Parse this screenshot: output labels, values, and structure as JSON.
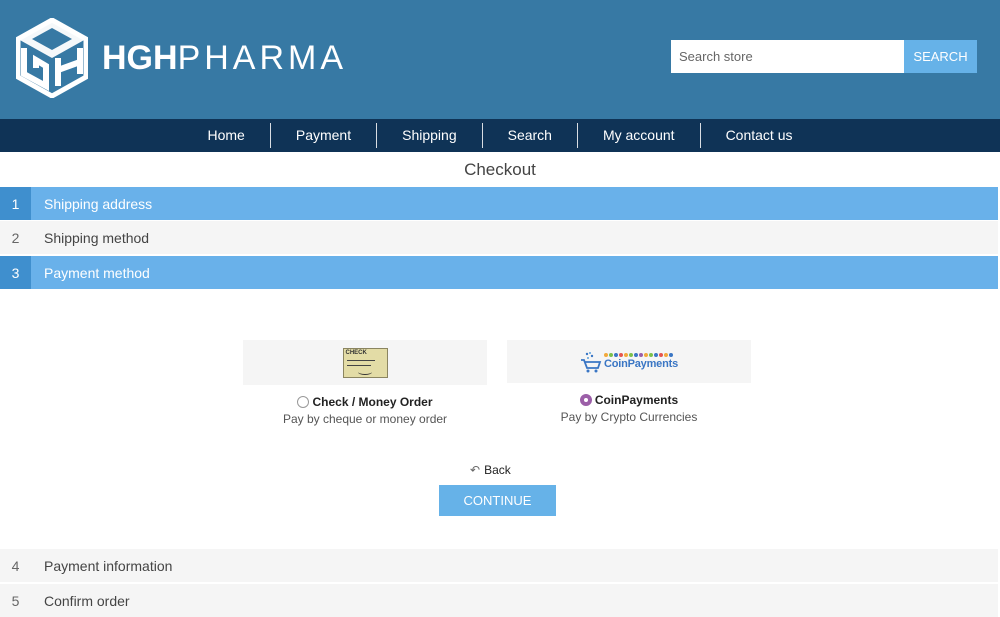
{
  "brand": {
    "logo_bold": "HGH",
    "logo_light": "PHARMA"
  },
  "search": {
    "placeholder": "Search store",
    "button_label": "SEARCH"
  },
  "nav": [
    "Home",
    "Payment",
    "Shipping",
    "Search",
    "My account",
    "Contact us"
  ],
  "checkout": {
    "title": "Checkout",
    "steps": [
      {
        "num": "1",
        "title": "Shipping address",
        "state": "active"
      },
      {
        "num": "2",
        "title": "Shipping method",
        "state": "inactive"
      },
      {
        "num": "3",
        "title": "Payment method",
        "state": "active"
      },
      {
        "num": "4",
        "title": "Payment information",
        "state": "inactive"
      },
      {
        "num": "5",
        "title": "Confirm order",
        "state": "inactive"
      }
    ],
    "payment_methods": [
      {
        "name": "Check / Money Order",
        "description": "Pay by cheque or money order",
        "selected": false,
        "image_text": "CHECK"
      },
      {
        "name": "CoinPayments",
        "description": "Pay by Crypto Currencies",
        "selected": true,
        "image_text": "CoinPayments"
      }
    ],
    "back_label": "Back",
    "continue_label": "CONTINUE"
  },
  "colors": {
    "header": "#3779a4",
    "nav": "#0f3356",
    "accent": "#66b2e8",
    "step_active": "#69b1ea",
    "step_num_active": "#3f8fce"
  },
  "icons": {
    "back": "back-arrow-icon",
    "logo": "hexagon-logo-icon",
    "cart": "cart-icon"
  }
}
